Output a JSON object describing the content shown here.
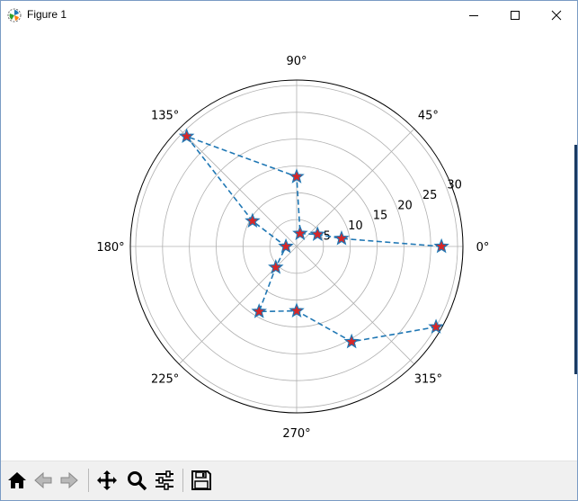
{
  "window": {
    "title": "Figure 1",
    "icons": {
      "app": "matplotlib-figure-icon",
      "minimize": "minimize-icon",
      "maximize": "maximize-icon",
      "close": "close-icon"
    }
  },
  "chart_data": {
    "type": "line",
    "projection": "polar",
    "angular_ticks": [
      "0°",
      "45°",
      "90°",
      "135°",
      "180°",
      "225°",
      "270°",
      "315°"
    ],
    "radial_ticks": [
      "5",
      "10",
      "15",
      "20",
      "25",
      "30"
    ],
    "rlim": [
      0,
      31
    ],
    "grid": true,
    "line_style": "dashed",
    "line_color": "#1f77b4",
    "marker": "star",
    "marker_face_color": "#d62728",
    "marker_edge_color": "#1f77b4",
    "points_theta_deg": [
      0,
      10,
      30,
      75,
      90,
      135,
      150,
      180,
      225,
      240,
      270,
      300,
      330
    ],
    "points_r": [
      27,
      8.5,
      4.5,
      2.5,
      13,
      29,
      9.5,
      2,
      5.5,
      14,
      12,
      20.5,
      30
    ]
  },
  "toolbar": {
    "items": [
      {
        "name": "home-button",
        "icon": "home-icon"
      },
      {
        "name": "back-button",
        "icon": "back-arrow-icon"
      },
      {
        "name": "forward-button",
        "icon": "forward-arrow-icon"
      },
      {
        "name": "pan-button",
        "icon": "pan-move-icon"
      },
      {
        "name": "zoom-button",
        "icon": "zoom-magnifier-icon"
      },
      {
        "name": "configure-subplots-button",
        "icon": "sliders-icon"
      },
      {
        "name": "save-button",
        "icon": "floppy-disk-icon"
      }
    ]
  }
}
